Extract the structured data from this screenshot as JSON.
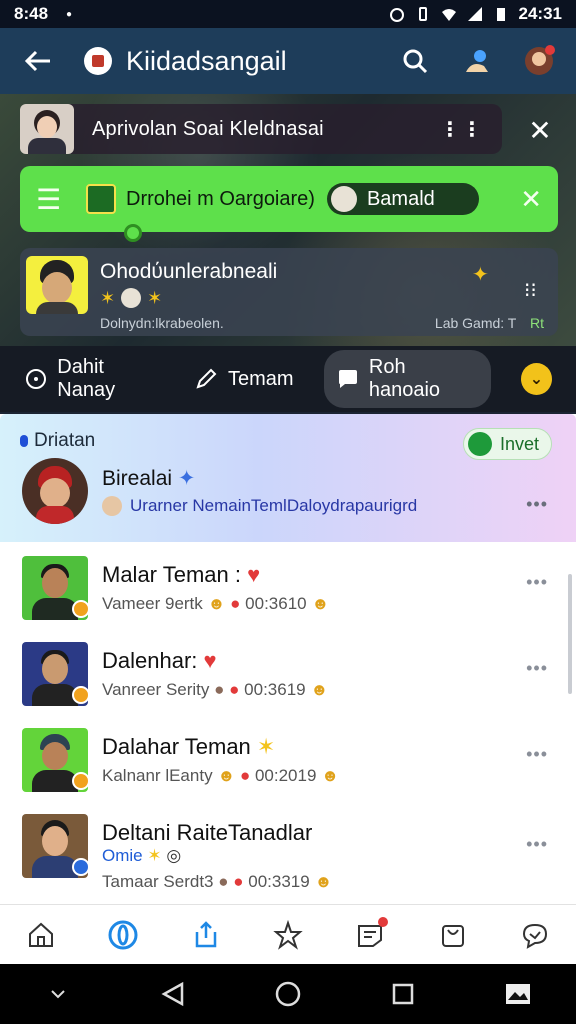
{
  "status_bar": {
    "time": "8:48",
    "clock_right": "24:31",
    "icons": [
      "alarm-icon",
      "vibrate-icon",
      "wifi-icon",
      "signal-icon",
      "battery-icon"
    ]
  },
  "app_bar": {
    "title": "Kiidadsangail"
  },
  "pinned": {
    "text": "Aprivolan Soai Kleldnasai"
  },
  "green_banner": {
    "chip_text": "Drrohei m Oargoiare)",
    "pill_text": "Bamald"
  },
  "feature_card": {
    "title": "Ohodύunlerabneali",
    "subtitle": "Dolnydn:lkrabeolen.",
    "right_text": "Lab Gamd: T",
    "badge": "Rt"
  },
  "tabs": [
    {
      "label": "Dahit  Nanay",
      "icon": "chat-icon"
    },
    {
      "label": "Temam",
      "icon": "pencil-icon"
    },
    {
      "label": "Roh hanoaio",
      "icon": "speech-bubble-icon"
    }
  ],
  "highlight": {
    "label": "Driatan",
    "invite": "Invet",
    "title": "Birealai",
    "subtitle": "Urarner NemainTemlDaloydrapaurigrd"
  },
  "rows": [
    {
      "name": "Malar Teman :",
      "sub": "Vameer 9ertk",
      "time": "00:3610"
    },
    {
      "name": "Dalenhar:",
      "sub": "Vanreer Serity",
      "time": "00:3619"
    },
    {
      "name": "Dalahar Teman",
      "sub": "Kalnanr lEanty",
      "time": "00:2019"
    },
    {
      "name": "Deltani RaiteTanadlar",
      "extra": "Omie",
      "sub": "Tamaar Serdt3",
      "time": "00:3319"
    }
  ],
  "bottom_nav": [
    "home-icon",
    "target-icon",
    "share-icon",
    "stars-icon",
    "notes-icon",
    "bag-icon",
    "message-icon"
  ],
  "system_nav": [
    "chevron-down-icon",
    "back-icon",
    "home-circle-icon",
    "recents-icon",
    "image-icon"
  ]
}
